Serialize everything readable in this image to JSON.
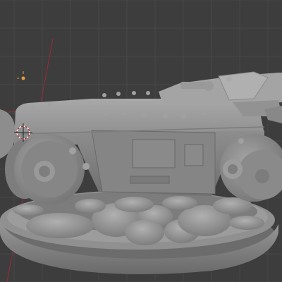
{
  "viewport": {
    "background_color": "#3d3d3d",
    "grid_color": "#484848",
    "model_color": "#8f8f8f",
    "y_axis_color": "#9b2b3a",
    "x_axis_color": "#8a2f38",
    "light_color": "#e0a040",
    "cursor_colors": [
      "#c83030",
      "#ffffff"
    ]
  },
  "scene": {
    "model": "tank-sculpt",
    "objects": [
      "tank-hull",
      "turret",
      "road-wheels",
      "base-plinth",
      "rocks"
    ]
  }
}
